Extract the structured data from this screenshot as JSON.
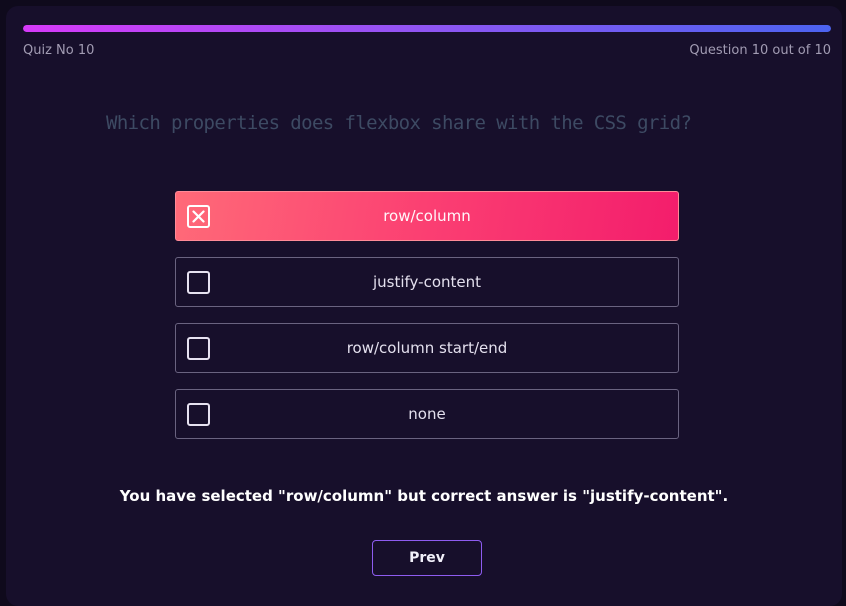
{
  "header": {
    "quiz_label": "Quiz No 10",
    "question_count": "Question 10 out of 10",
    "progress_fraction": 1.0
  },
  "question": {
    "text": "Which properties does flexbox share with the CSS grid?"
  },
  "options": [
    {
      "label": "row/column",
      "selected": true
    },
    {
      "label": "justify-content",
      "selected": false
    },
    {
      "label": "row/column start/end",
      "selected": false
    },
    {
      "label": "none",
      "selected": false
    }
  ],
  "result": {
    "text": "You have selected \"row/column\" but correct answer is \"justify-content\"."
  },
  "nav": {
    "prev_label": "Prev"
  },
  "colors": {
    "selected_gradient_start": "#ff6a78",
    "selected_gradient_end": "#f31d6c",
    "progress_start": "#d63af9",
    "progress_end": "#4c63f0",
    "background": "#170f2b"
  },
  "icons": {
    "selected_checkbox": "x-checkbox-icon",
    "unselected_checkbox": "empty-checkbox-icon"
  }
}
